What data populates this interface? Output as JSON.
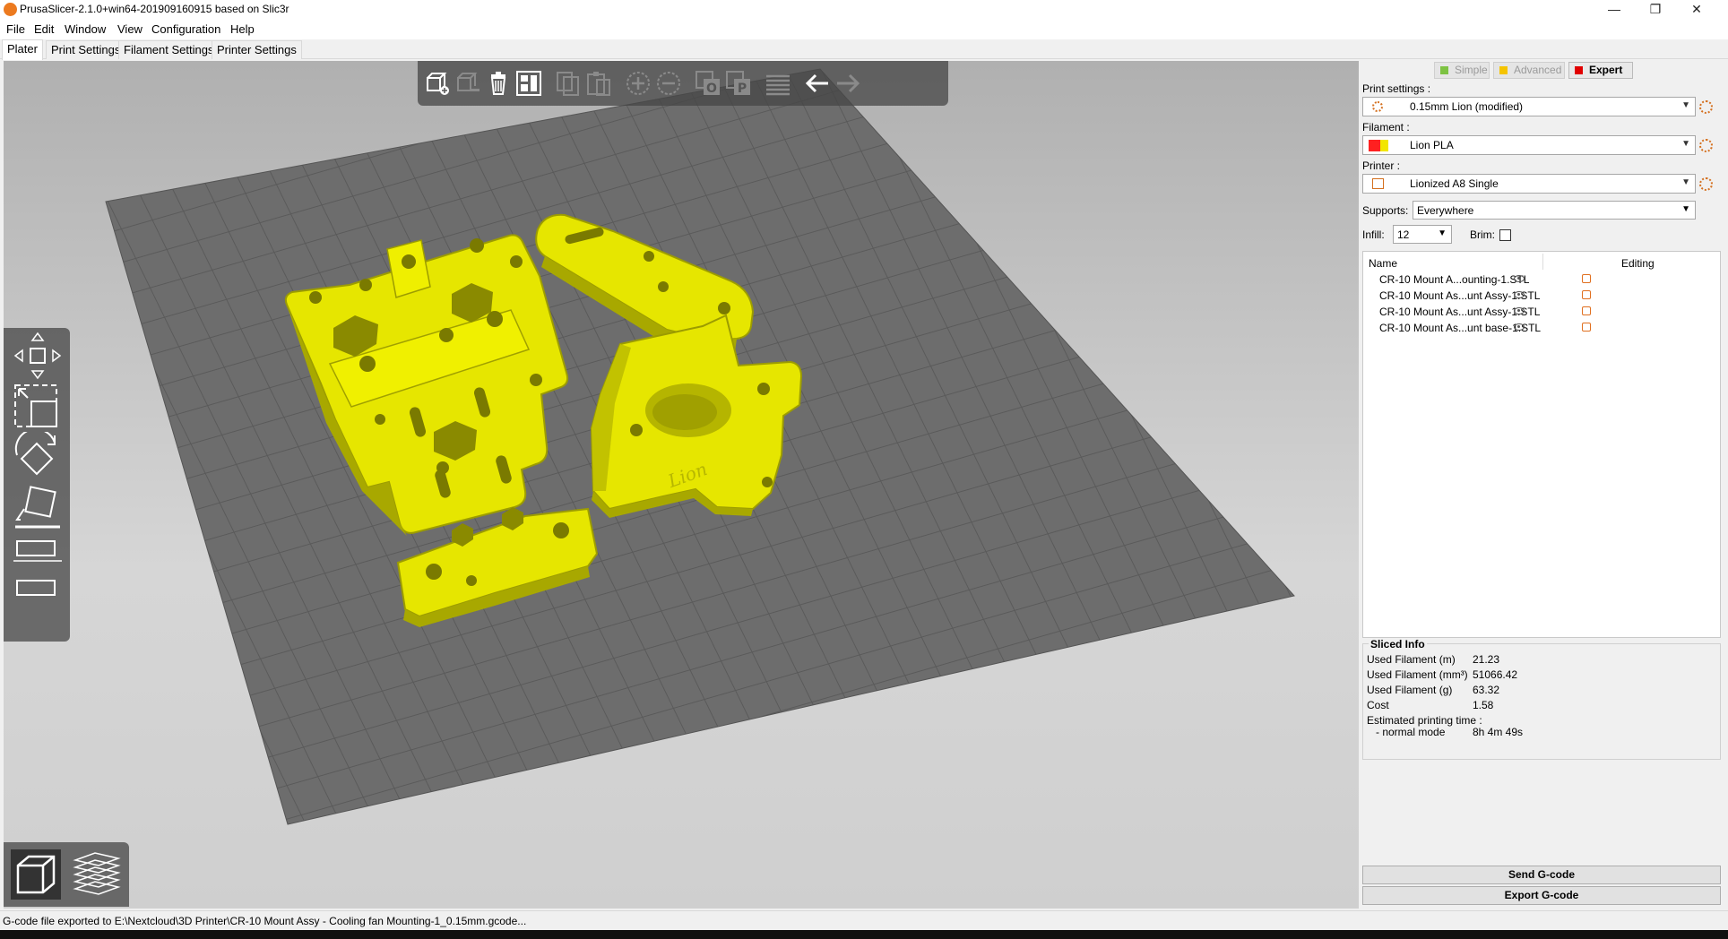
{
  "window": {
    "title": "PrusaSlicer-2.1.0+win64-201909160915 based on Slic3r",
    "minimize": "—",
    "maximize": "❐",
    "close": "✕"
  },
  "menu": [
    "File",
    "Edit",
    "Window",
    "View",
    "Configuration",
    "Help"
  ],
  "tabs": [
    "Plater",
    "Print Settings",
    "Filament Settings",
    "Printer Settings"
  ],
  "top_toolbar_icons": [
    "add-icon",
    "delete-icon",
    "delete-all-icon",
    "arrange-icon",
    "copy-icon",
    "paste-icon",
    "add-instance-icon",
    "remove-instance-icon",
    "split-objects-icon",
    "split-parts-icon",
    "layers-editing-icon",
    "undo-icon",
    "redo-icon"
  ],
  "left_toolbar_icons": [
    "move-icon",
    "scale-icon",
    "rotate-icon",
    "place-on-face-icon",
    "cut-icon",
    "support-points-icon"
  ],
  "view_toggle_icons": [
    "3d-view-icon",
    "preview-icon"
  ],
  "modes": {
    "simple": "Simple",
    "advanced": "Advanced",
    "expert": "Expert",
    "simple_color": "#7dc242",
    "advanced_color": "#f5c400",
    "expert_color": "#e10000"
  },
  "settings": {
    "print_label": "Print settings :",
    "print_value": "0.15mm Lion (modified)",
    "filament_label": "Filament :",
    "filament_value": "Lion PLA",
    "filament_colors": [
      "#ff2020",
      "#f2e600"
    ],
    "printer_label": "Printer :",
    "printer_value": "Lionized A8 Single",
    "supports_label": "Supports:",
    "supports_value": "Everywhere",
    "infill_label": "Infill:",
    "infill_value": "12",
    "brim_label": "Brim:",
    "brim_checked": false
  },
  "object_list": {
    "col_name": "Name",
    "col_editing": "Editing",
    "items": [
      "CR-10 Mount A...ounting-1.STL",
      "CR-10 Mount As...unt Assy-1.STL",
      "CR-10 Mount As...unt Assy-1.STL",
      "CR-10 Mount As...unt base-1.STL"
    ]
  },
  "sliced_info": {
    "title": "Sliced Info",
    "rows": [
      {
        "label": "Used Filament (m)",
        "value": "21.23"
      },
      {
        "label": "Used Filament (mm³)",
        "value": "51066.42"
      },
      {
        "label": "Used Filament (g)",
        "value": "63.32"
      },
      {
        "label": "Cost",
        "value": "1.58"
      }
    ],
    "time_label": "Estimated printing time :",
    "mode_label": "- normal mode",
    "mode_value": "8h 4m 49s"
  },
  "buttons": {
    "send": "Send G-code",
    "export": "Export G-code"
  },
  "status": "G-code file exported to E:\\Nextcloud\\3D Printer\\CR-10 Mount Assy - Cooling fan Mounting-1_0.15mm.gcode...",
  "model_color": "#e6e600"
}
